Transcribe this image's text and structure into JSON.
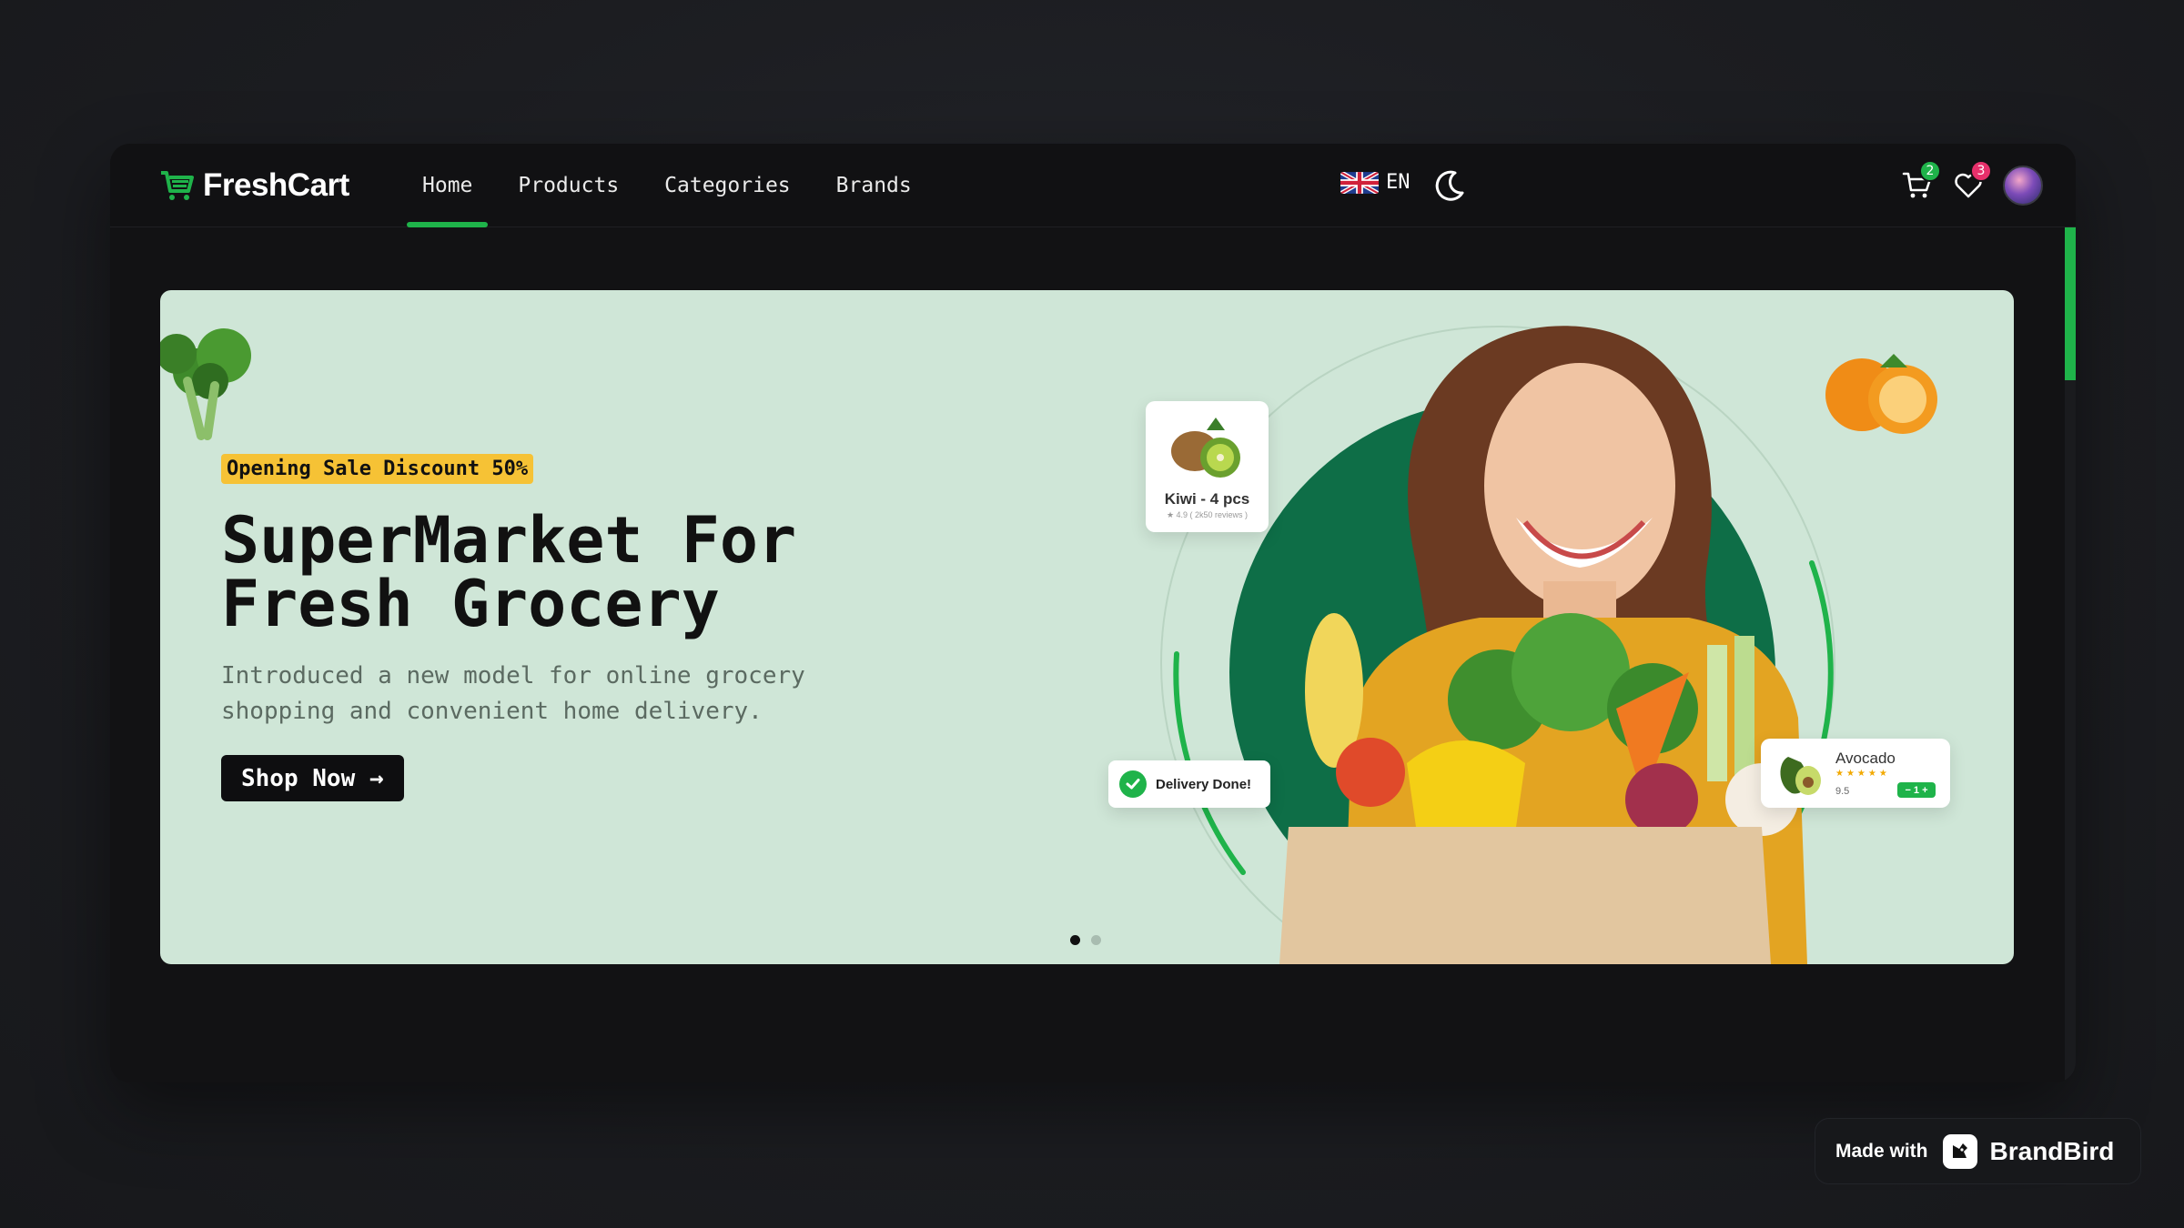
{
  "app": {
    "brand_name": "FreshCart",
    "brand_color": "#1fb34a"
  },
  "nav": {
    "items": [
      {
        "label": "Home",
        "active": true
      },
      {
        "label": "Products",
        "active": false
      },
      {
        "label": "Categories",
        "active": false
      },
      {
        "label": "Brands",
        "active": false
      }
    ]
  },
  "language": {
    "code": "EN",
    "flag_icon": "uk-flag-icon"
  },
  "theme_toggle": {
    "icon": "moon-icon"
  },
  "cart": {
    "icon": "cart-icon",
    "count": "2",
    "badge_color": "#1fb34a"
  },
  "wishlist": {
    "icon": "heart-icon",
    "count": "3",
    "badge_color": "#e6306b"
  },
  "hero": {
    "badge": "Opening Sale Discount 50%",
    "title": "SuperMarket For\nFresh Grocery",
    "subtitle": "Introduced a new model for online grocery shopping and convenient home delivery.",
    "cta": "Shop Now →",
    "background": "#cfe6d7",
    "kiwi_card": {
      "name": "Kiwi - 4 pcs",
      "rating": "★ 4.9  ( 2k50 reviews )"
    },
    "delivery_card": {
      "text": "Delivery Done!"
    },
    "avocado_card": {
      "name": "Avocado",
      "stars": "★★★★★",
      "price": "9.5",
      "stepper": "− 1 +"
    },
    "slides": {
      "count": 2,
      "active": 1
    }
  },
  "footer_badge": {
    "made_with": "Made with",
    "brand": "BrandBird"
  }
}
